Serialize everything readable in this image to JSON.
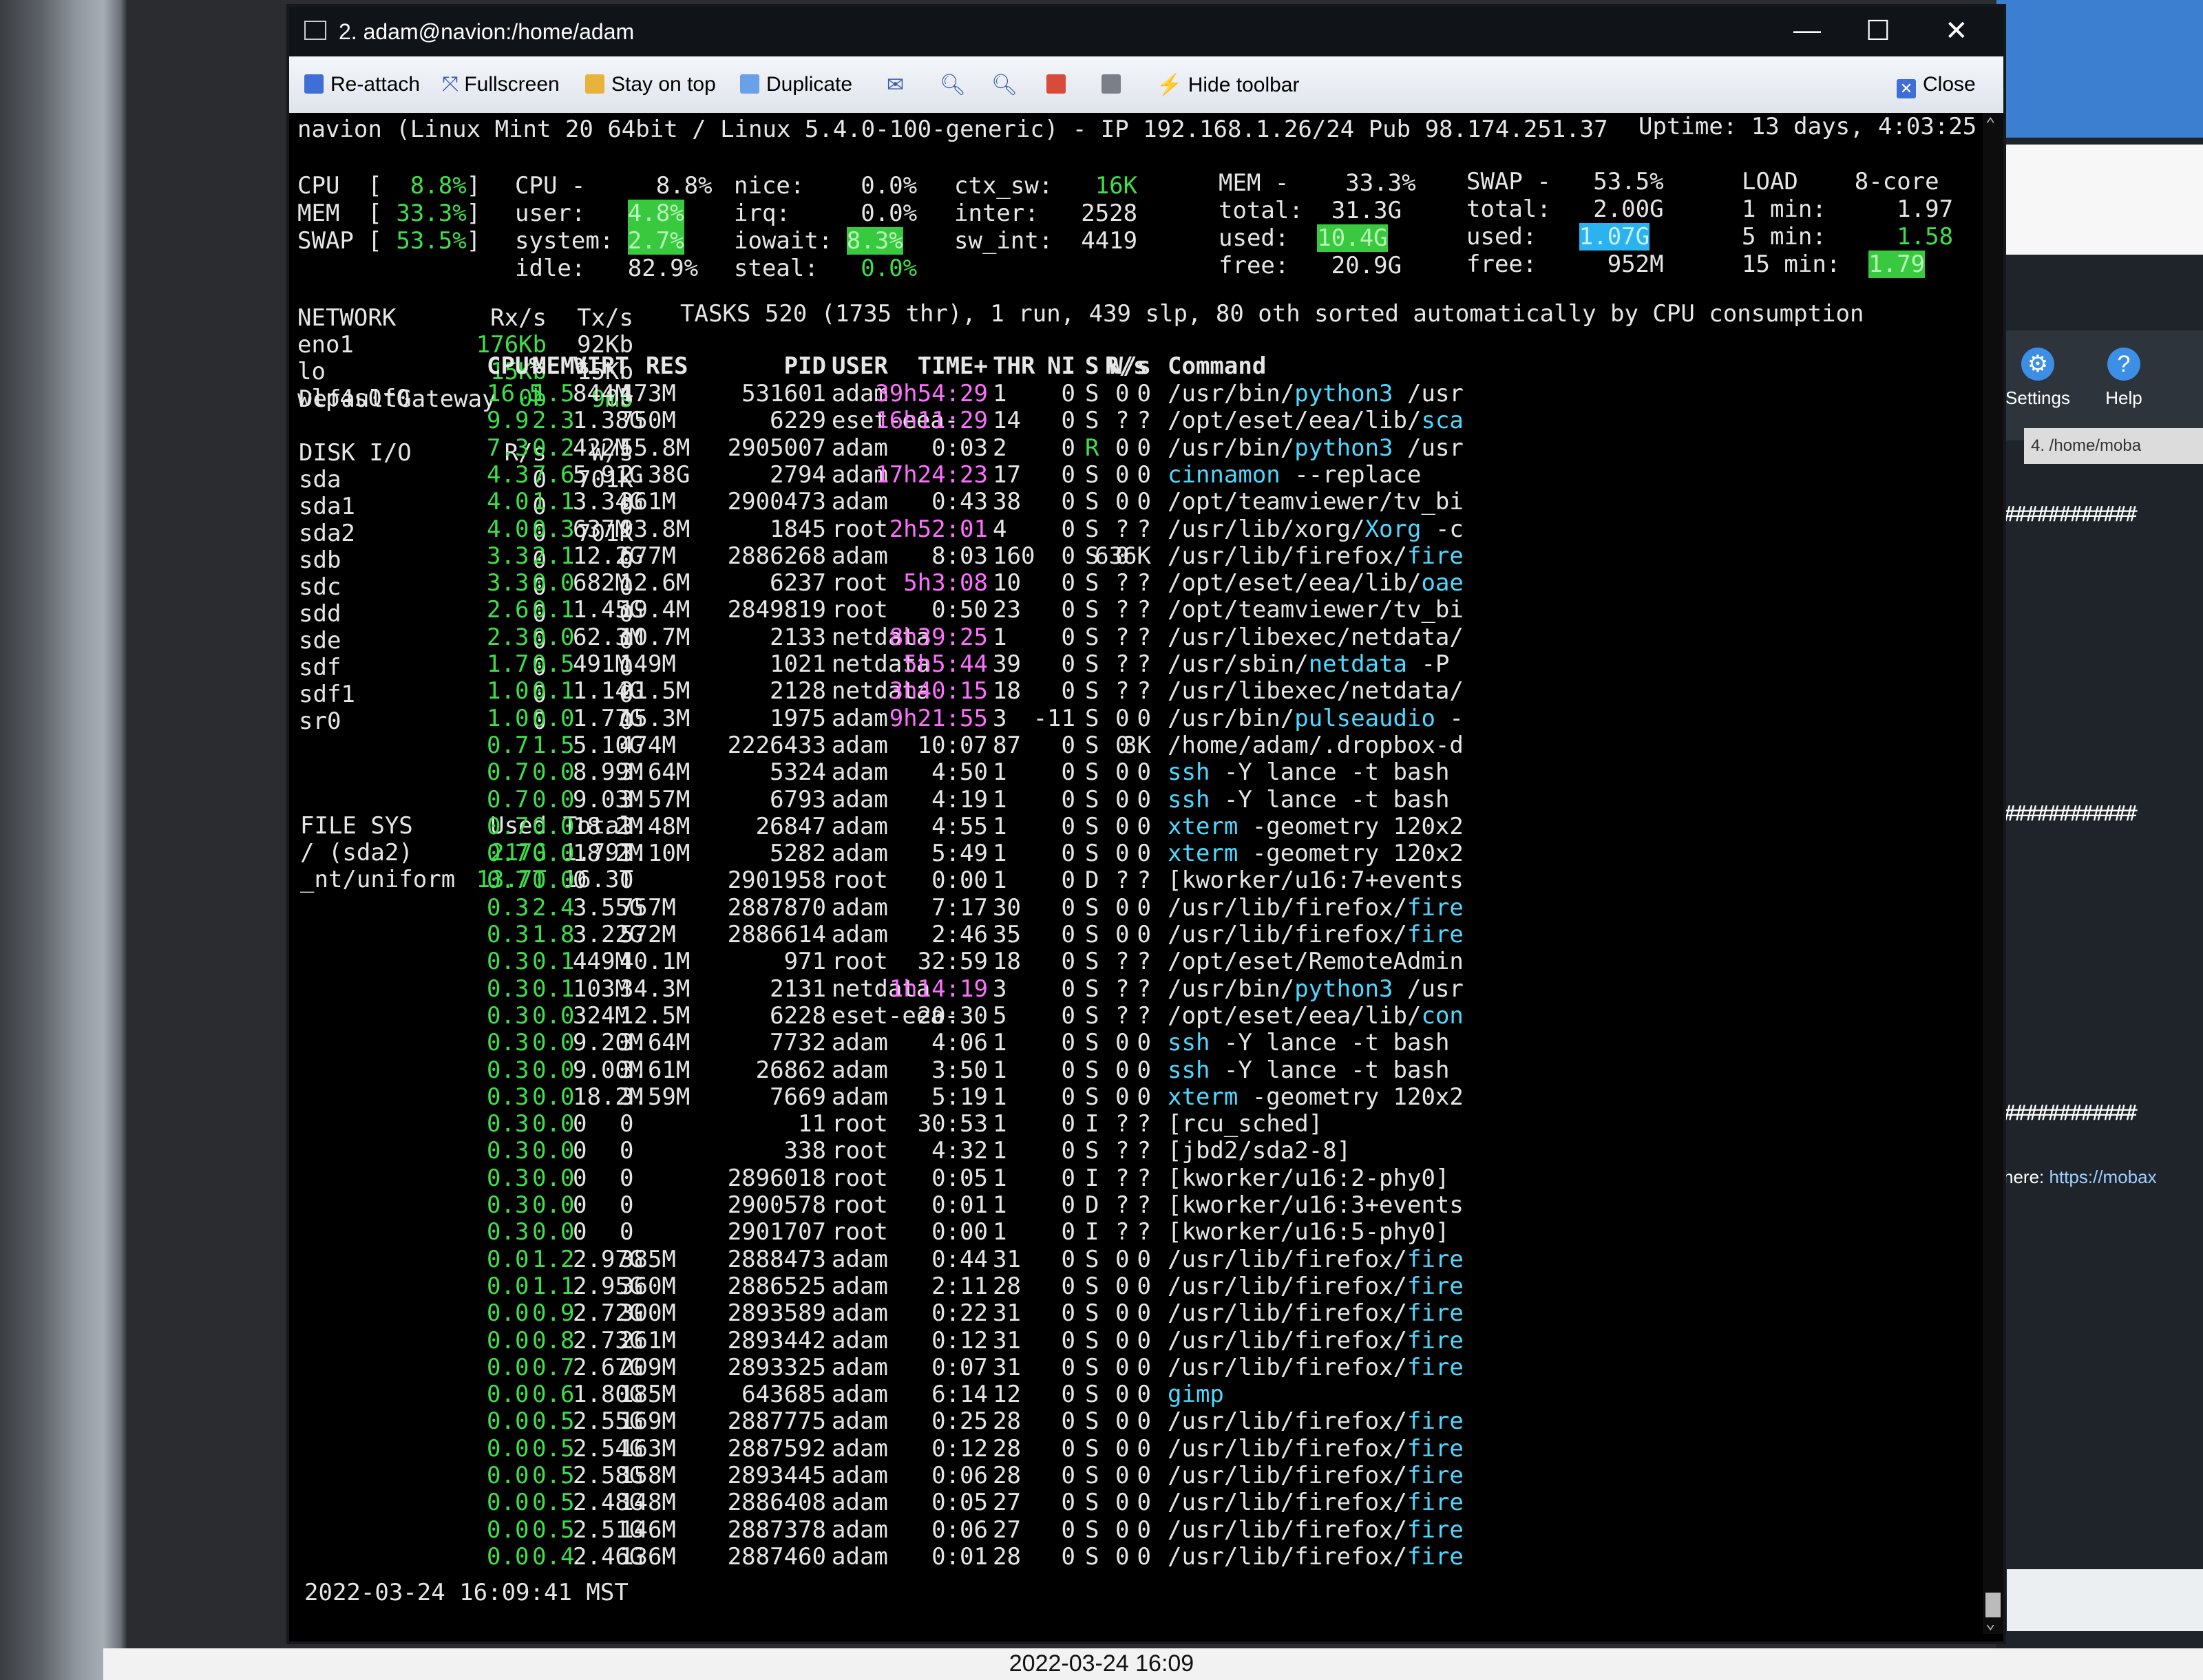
{
  "window": {
    "title": "2. adam@navion:/home/adam",
    "minimize": "—",
    "maximize": "☐",
    "close": "✕"
  },
  "toolbar": {
    "reattach": "Re-attach",
    "fullscreen": "Fullscreen",
    "stay_on_top": "Stay on top",
    "duplicate": "Duplicate",
    "hide_toolbar": "Hide toolbar",
    "close": "Close"
  },
  "header": {
    "host": "navion (Linux Mint 20 64bit / Linux 5.4.0-100-generic) - IP 192.168.1.26/24 Pub 98.174.251.37",
    "uptime": "Uptime: 13 days, 4:03:25"
  },
  "summary": {
    "bars": [
      {
        "label": "CPU",
        "value": "8.8%"
      },
      {
        "label": "MEM",
        "value": "33.3%"
      },
      {
        "label": "SWAP",
        "value": "53.5%"
      }
    ],
    "cpu": {
      "label": "CPU -",
      "total": "8.8%",
      "user": "4.8%",
      "system": "2.7%",
      "idle": "82.9%",
      "nice": "0.0%",
      "irq": "0.0%",
      "iowait": "8.3%",
      "steal": "0.0%",
      "ctx_sw": "16K",
      "inter": "2528",
      "sw_int": "4419"
    },
    "mem": {
      "label": "MEM -",
      "pct": "33.3%",
      "total": "31.3G",
      "used": "10.4G",
      "free": "20.9G"
    },
    "swap": {
      "label": "SWAP -",
      "pct": "53.5%",
      "total": "2.00G",
      "used": "1.07G",
      "free": "952M"
    },
    "load": {
      "label": "LOAD",
      "cores": "8-core",
      "m1": "1.97",
      "m5": "1.58",
      "m15": "1.79"
    }
  },
  "network": {
    "header": [
      "NETWORK",
      "Rx/s",
      "Tx/s"
    ],
    "rows": [
      [
        "eno1",
        "176Kb",
        "92Kb"
      ],
      [
        "lo",
        "15Kb",
        "15Kb"
      ],
      [
        "wlp4s0f0",
        "0b",
        "0b"
      ]
    ],
    "gateway": [
      "DefaultGateway",
      "9ms"
    ]
  },
  "disk": {
    "header": [
      "DISK I/O",
      "R/s",
      "W/s"
    ],
    "rows": [
      [
        "sda",
        "0",
        "701K"
      ],
      [
        "sda1",
        "0",
        "0"
      ],
      [
        "sda2",
        "0",
        "701K"
      ],
      [
        "sdb",
        "0",
        "0"
      ],
      [
        "sdc",
        "0",
        "0"
      ],
      [
        "sdd",
        "0",
        "0"
      ],
      [
        "sde",
        "0",
        "0"
      ],
      [
        "sdf",
        "0",
        "0"
      ],
      [
        "sdf1",
        "0",
        "0"
      ],
      [
        "sr0",
        "0",
        "0"
      ]
    ]
  },
  "fs": {
    "header": [
      "FILE SYS",
      "Used",
      "Total"
    ],
    "rows": [
      [
        "/ (sda2)",
        "217G",
        "1.79T"
      ],
      [
        "_nt/uniform",
        "13.7T",
        "16.3T"
      ]
    ]
  },
  "tasks": "TASKS 520 (1735 thr), 1 run, 439 slp, 80 oth sorted automatically by CPU consumption",
  "proc_header": [
    "CPU%",
    "MEM%",
    "VIRT",
    "RES",
    "PID",
    "USER",
    "TIME+",
    "THR",
    "NI",
    "S",
    "R/s",
    "W/s",
    "Command"
  ],
  "processes": [
    [
      "16.5",
      "1.5",
      "844M",
      "473M",
      "531601",
      "adam",
      "39h54:29",
      "1",
      "0",
      "S",
      "0",
      "0",
      "/usr/bin/",
      "python3",
      " /usr"
    ],
    [
      "9.9",
      "2.3",
      "1.38G",
      "750M",
      "6229",
      "eset-eea-",
      "16h11:29",
      "14",
      "0",
      "S",
      "?",
      "?",
      "/opt/eset/eea/lib/",
      "sca",
      ""
    ],
    [
      "7.3",
      "0.2",
      "422M",
      "55.8M",
      "2905007",
      "adam",
      "0:03",
      "2",
      "0",
      "R",
      "0",
      "0",
      "/usr/bin/",
      "python3",
      " /usr"
    ],
    [
      "4.3",
      "7.6",
      "5.91G",
      "2.38G",
      "2794",
      "adam",
      "17h24:23",
      "17",
      "0",
      "S",
      "0",
      "0",
      "",
      "cinnamon",
      " --replace"
    ],
    [
      "4.0",
      "1.1",
      "3.34G",
      "361M",
      "2900473",
      "adam",
      "0:43",
      "38",
      "0",
      "S",
      "0",
      "0",
      "/opt/teamviewer/tv_bi",
      "",
      ""
    ],
    [
      "4.0",
      "0.3",
      "637M",
      "93.8M",
      "1845",
      "root",
      "2h52:01",
      "4",
      "0",
      "S",
      "?",
      "?",
      "/usr/lib/xorg/",
      "Xorg",
      " -c"
    ],
    [
      "3.3",
      "2.1",
      "12.2G",
      "677M",
      "2886268",
      "adam",
      "8:03",
      "160",
      "0",
      "S",
      "0",
      "636K",
      "/usr/lib/firefox/",
      "fire",
      ""
    ],
    [
      "3.3",
      "0.0",
      "682M",
      "12.6M",
      "6237",
      "root",
      "5h3:08",
      "10",
      "0",
      "S",
      "?",
      "?",
      "/opt/eset/eea/lib/",
      "oae",
      ""
    ],
    [
      "2.6",
      "0.1",
      "1.45G",
      "19.4M",
      "2849819",
      "root",
      "0:50",
      "23",
      "0",
      "S",
      "?",
      "?",
      "/opt/teamviewer/tv_bi",
      "",
      ""
    ],
    [
      "2.3",
      "0.0",
      "62.3M",
      "10.7M",
      "2133",
      "netdata",
      "8h39:25",
      "1",
      "0",
      "S",
      "?",
      "?",
      "/usr/libexec/netdata/",
      "",
      ""
    ],
    [
      "1.7",
      "0.5",
      "491M",
      "149M",
      "1021",
      "netdata",
      "5h5:44",
      "39",
      "0",
      "S",
      "?",
      "?",
      "/usr/sbin/",
      "netdata",
      " -P"
    ],
    [
      "1.0",
      "0.1",
      "1.14G",
      "21.5M",
      "2128",
      "netdata",
      "3h40:15",
      "18",
      "0",
      "S",
      "?",
      "?",
      "/usr/libexec/netdata/",
      "",
      ""
    ],
    [
      "1.0",
      "0.0",
      "1.77G",
      "15.3M",
      "1975",
      "adam",
      "9h21:55",
      "3",
      "-11",
      "S",
      "0",
      "0",
      "/usr/bin/",
      "pulseaudio",
      " -"
    ],
    [
      "0.7",
      "1.5",
      "5.10G",
      "474M",
      "2226433",
      "adam",
      "10:07",
      "87",
      "0",
      "S",
      "0",
      "3K",
      "/home/adam/.dropbox-d",
      "",
      ""
    ],
    [
      "0.7",
      "0.0",
      "8.99M",
      "3.64M",
      "5324",
      "adam",
      "4:50",
      "1",
      "0",
      "S",
      "0",
      "0",
      "",
      "ssh",
      " -Y lance -t bash"
    ],
    [
      "0.7",
      "0.0",
      "9.03M",
      "3.57M",
      "6793",
      "adam",
      "4:19",
      "1",
      "0",
      "S",
      "0",
      "0",
      "",
      "ssh",
      " -Y lance -t bash"
    ],
    [
      "0.7",
      "0.0",
      "18.2M",
      "3.48M",
      "26847",
      "adam",
      "4:55",
      "1",
      "0",
      "S",
      "0",
      "0",
      "",
      "xterm",
      " -geometry 120x2"
    ],
    [
      "0.7",
      "0.0",
      "18.2M",
      "3.10M",
      "5282",
      "adam",
      "5:49",
      "1",
      "0",
      "S",
      "0",
      "0",
      "",
      "xterm",
      " -geometry 120x2"
    ],
    [
      "0.7",
      "0.0",
      "0",
      "0",
      "2901958",
      "root",
      "0:00",
      "1",
      "0",
      "D",
      "?",
      "?",
      "[kworker/u16:7+events",
      "",
      ""
    ],
    [
      "0.3",
      "2.4",
      "3.55G",
      "757M",
      "2887870",
      "adam",
      "7:17",
      "30",
      "0",
      "S",
      "0",
      "0",
      "/usr/lib/firefox/",
      "fire",
      ""
    ],
    [
      "0.3",
      "1.8",
      "3.22G",
      "572M",
      "2886614",
      "adam",
      "2:46",
      "35",
      "0",
      "S",
      "0",
      "0",
      "/usr/lib/firefox/",
      "fire",
      ""
    ],
    [
      "0.3",
      "0.1",
      "449M",
      "40.1M",
      "971",
      "root",
      "32:59",
      "18",
      "0",
      "S",
      "?",
      "?",
      "/opt/eset/RemoteAdmin",
      "",
      ""
    ],
    [
      "0.3",
      "0.1",
      "103M",
      "34.3M",
      "2131",
      "netdata",
      "1h14:19",
      "3",
      "0",
      "S",
      "?",
      "?",
      "/usr/bin/",
      "python3",
      " /usr"
    ],
    [
      "0.3",
      "0.0",
      "324M",
      "12.5M",
      "6228",
      "eset-eea-",
      "20:30",
      "5",
      "0",
      "S",
      "?",
      "?",
      "/opt/eset/eea/lib/",
      "con",
      ""
    ],
    [
      "0.3",
      "0.0",
      "9.20M",
      "3.64M",
      "7732",
      "adam",
      "4:06",
      "1",
      "0",
      "S",
      "0",
      "0",
      "",
      "ssh",
      " -Y lance -t bash"
    ],
    [
      "0.3",
      "0.0",
      "9.00M",
      "3.61M",
      "26862",
      "adam",
      "3:50",
      "1",
      "0",
      "S",
      "0",
      "0",
      "",
      "ssh",
      " -Y lance -t bash"
    ],
    [
      "0.3",
      "0.0",
      "18.2M",
      "3.59M",
      "7669",
      "adam",
      "5:19",
      "1",
      "0",
      "S",
      "0",
      "0",
      "",
      "xterm",
      " -geometry 120x2"
    ],
    [
      "0.3",
      "0.0",
      "0",
      "0",
      "11",
      "root",
      "30:53",
      "1",
      "0",
      "I",
      "?",
      "?",
      "[rcu_sched]",
      "",
      ""
    ],
    [
      "0.3",
      "0.0",
      "0",
      "0",
      "338",
      "root",
      "4:32",
      "1",
      "0",
      "S",
      "?",
      "?",
      "[jbd2/sda2-8]",
      "",
      ""
    ],
    [
      "0.3",
      "0.0",
      "0",
      "0",
      "2896018",
      "root",
      "0:05",
      "1",
      "0",
      "I",
      "?",
      "?",
      "[kworker/u16:2-phy0]",
      "",
      ""
    ],
    [
      "0.3",
      "0.0",
      "0",
      "0",
      "2900578",
      "root",
      "0:01",
      "1",
      "0",
      "D",
      "?",
      "?",
      "[kworker/u16:3+events",
      "",
      ""
    ],
    [
      "0.3",
      "0.0",
      "0",
      "0",
      "2901707",
      "root",
      "0:00",
      "1",
      "0",
      "I",
      "?",
      "?",
      "[kworker/u16:5-phy0]",
      "",
      ""
    ],
    [
      "0.0",
      "1.2",
      "2.97G",
      "385M",
      "2888473",
      "adam",
      "0:44",
      "31",
      "0",
      "S",
      "0",
      "0",
      "/usr/lib/firefox/",
      "fire",
      ""
    ],
    [
      "0.0",
      "1.1",
      "2.95G",
      "360M",
      "2886525",
      "adam",
      "2:11",
      "28",
      "0",
      "S",
      "0",
      "0",
      "/usr/lib/firefox/",
      "fire",
      ""
    ],
    [
      "0.0",
      "0.9",
      "2.72G",
      "300M",
      "2893589",
      "adam",
      "0:22",
      "31",
      "0",
      "S",
      "0",
      "0",
      "/usr/lib/firefox/",
      "fire",
      ""
    ],
    [
      "0.0",
      "0.8",
      "2.73G",
      "261M",
      "2893442",
      "adam",
      "0:12",
      "31",
      "0",
      "S",
      "0",
      "0",
      "/usr/lib/firefox/",
      "fire",
      ""
    ],
    [
      "0.0",
      "0.7",
      "2.67G",
      "209M",
      "2893325",
      "adam",
      "0:07",
      "31",
      "0",
      "S",
      "0",
      "0",
      "/usr/lib/firefox/",
      "fire",
      ""
    ],
    [
      "0.0",
      "0.6",
      "1.80G",
      "185M",
      "643685",
      "adam",
      "6:14",
      "12",
      "0",
      "S",
      "0",
      "0",
      "",
      "gimp",
      ""
    ],
    [
      "0.0",
      "0.5",
      "2.55G",
      "169M",
      "2887775",
      "adam",
      "0:25",
      "28",
      "0",
      "S",
      "0",
      "0",
      "/usr/lib/firefox/",
      "fire",
      ""
    ],
    [
      "0.0",
      "0.5",
      "2.54G",
      "163M",
      "2887592",
      "adam",
      "0:12",
      "28",
      "0",
      "S",
      "0",
      "0",
      "/usr/lib/firefox/",
      "fire",
      ""
    ],
    [
      "0.0",
      "0.5",
      "2.58G",
      "158M",
      "2893445",
      "adam",
      "0:06",
      "28",
      "0",
      "S",
      "0",
      "0",
      "/usr/lib/firefox/",
      "fire",
      ""
    ],
    [
      "0.0",
      "0.5",
      "2.48G",
      "148M",
      "2886408",
      "adam",
      "0:05",
      "27",
      "0",
      "S",
      "0",
      "0",
      "/usr/lib/firefox/",
      "fire",
      ""
    ],
    [
      "0.0",
      "0.5",
      "2.51G",
      "146M",
      "2887378",
      "adam",
      "0:06",
      "27",
      "0",
      "S",
      "0",
      "0",
      "/usr/lib/firefox/",
      "fire",
      ""
    ],
    [
      "0.0",
      "0.4",
      "2.46G",
      "136M",
      "2887460",
      "adam",
      "0:01",
      "28",
      "0",
      "S",
      "0",
      "0",
      "/usr/lib/firefox/",
      "fire",
      ""
    ]
  ],
  "footer_time": "2022-03-24 16:09:41 MST",
  "photo_timestamp": "2022-03-24 16:09",
  "side_panel": {
    "settings": "Settings",
    "help": "Help",
    "tab": "4. /home/moba",
    "hash": "############",
    "link_prefix": "here:",
    "link": "https://mobax"
  },
  "colors": {
    "green": "#3fdf4a",
    "magenta": "#ff6fff",
    "cyan": "#4fd8ff"
  }
}
